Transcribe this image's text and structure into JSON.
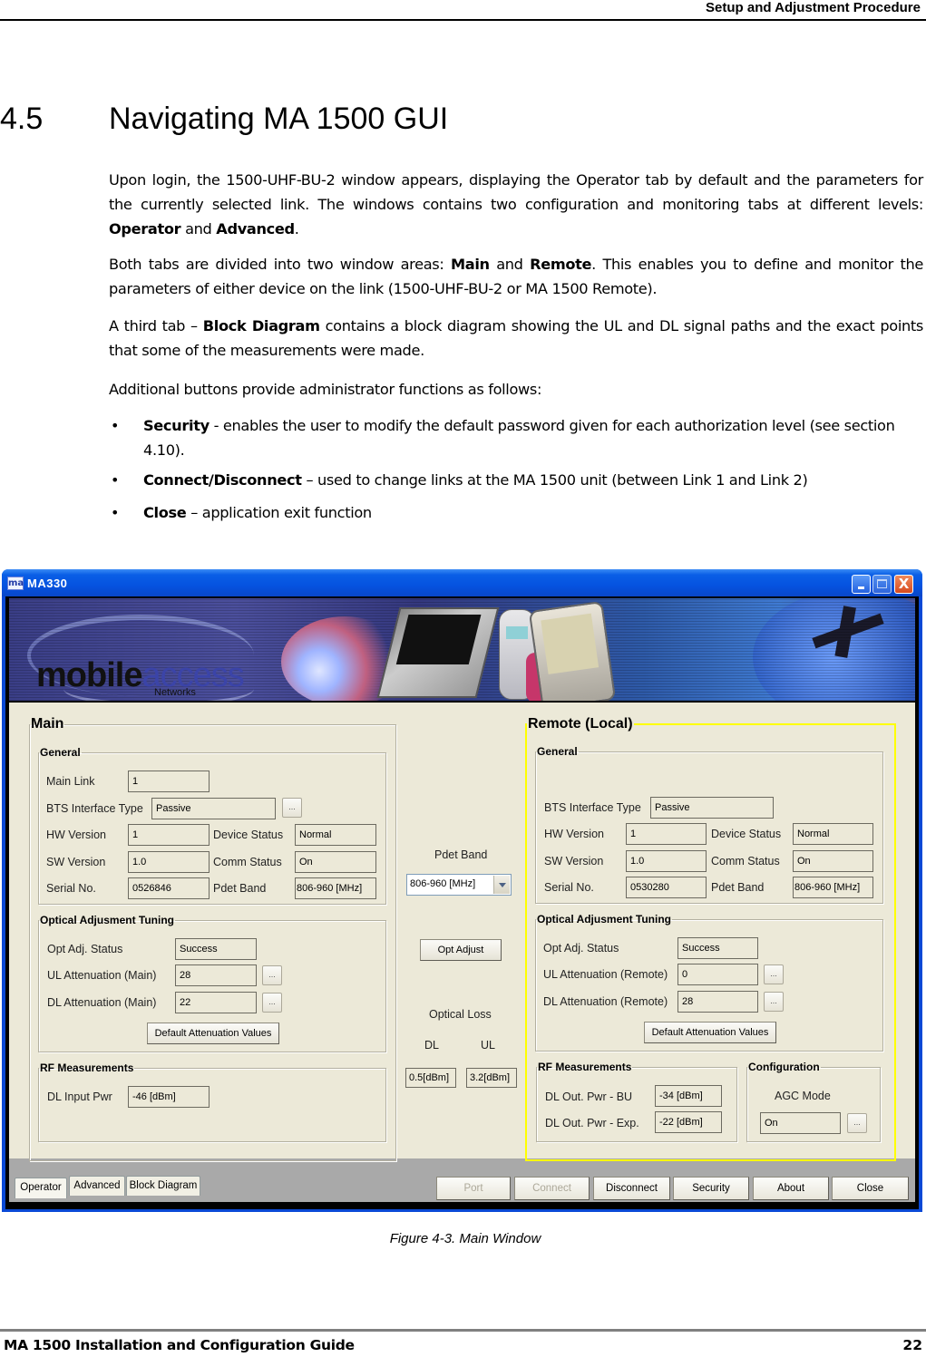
{
  "document": {
    "running_header": "Setup and Adjustment Procedure",
    "section_number": "4.5",
    "section_title": "Navigating MA 1500 GUI",
    "paragraphs": {
      "p1_a": "Upon login, the 1500-UHF-BU-2 window appears, displaying the Operator tab by default and the parameters for the currently selected link.  The windows contains two configuration and monitoring tabs at different levels: ",
      "p1_b1": "Operator",
      "p1_c": " and ",
      "p1_b2": "Advanced",
      "p1_d": ".",
      "p2_a": "Both tabs are divided into two window areas: ",
      "p2_b1": "Main",
      "p2_c": " and ",
      "p2_b2": "Remote",
      "p2_d": ". This enables you to define and monitor the parameters of either device on the link (1500-UHF-BU-2 or MA 1500 Remote).",
      "p3_a": "A third tab – ",
      "p3_b": "Block Diagram",
      "p3_c": " contains a block diagram showing the UL and DL signal paths and the exact points that some of the measurements were made.",
      "p4": "Additional buttons provide administrator functions as follows:"
    },
    "bullets": [
      {
        "term": "Security",
        "text": " - enables the user to modify the default password given for each authorization level (see section 4.10)."
      },
      {
        "term": "Connect/Disconnect",
        "text": " – used to change links at the MA 1500 unit (between Link 1 and Link 2)"
      },
      {
        "term": "Close",
        "text": " – application exit function"
      }
    ],
    "figure_caption": "Figure 4-3. Main Window",
    "footer_title": "MA 1500 Installation and Configuration Guide",
    "page_number": "22"
  },
  "window": {
    "title": "MA330",
    "app_icon_text": "ma",
    "close_glyph": "X",
    "banner": {
      "logo_part1": "mobile",
      "logo_part2": "access",
      "logo_sub": "Networks"
    },
    "main": {
      "legend": "Main",
      "general": {
        "legend": "General",
        "main_link_label": "Main Link",
        "main_link_value": "1",
        "bts_label": "BTS Interface Type",
        "bts_value": "Passive",
        "hw_label": "HW Version",
        "hw_value": "1",
        "sw_label": "SW Version",
        "sw_value": "1.0",
        "serial_label": "Serial No.",
        "serial_value": "0526846",
        "device_status_label": "Device Status",
        "device_status_value": "Normal",
        "comm_status_label": "Comm Status",
        "comm_status_value": "On",
        "pdet_label": "Pdet Band",
        "pdet_value": "806-960 [MHz]"
      },
      "optical": {
        "legend": "Optical Adjusment Tuning",
        "status_label": "Opt Adj. Status",
        "status_value": "Success",
        "ul_label": "UL Attenuation (Main)",
        "ul_value": "28",
        "dl_label": "DL Attenuation (Main)",
        "dl_value": "22",
        "default_button": "Default Attenuation Values"
      },
      "rf": {
        "legend": "RF Measurements",
        "dl_input_label": "DL Input Pwr",
        "dl_input_value": "-46 [dBm]"
      }
    },
    "center": {
      "pdet_band_label": "Pdet Band",
      "pdet_band_selected": "806-960 [MHz]",
      "opt_adjust_button": "Opt Adjust",
      "optical_loss_label": "Optical Loss",
      "dl_label": "DL",
      "ul_label": "UL",
      "dl_value": "0.5[dBm]",
      "ul_value": "3.2[dBm]"
    },
    "remote": {
      "legend": "Remote (Local)",
      "highlight_color": "#ffff00",
      "general": {
        "legend": "General",
        "bts_label": "BTS Interface Type",
        "bts_value": "Passive",
        "hw_label": "HW Version",
        "hw_value": "1",
        "sw_label": "SW Version",
        "sw_value": "1.0",
        "serial_label": "Serial No.",
        "serial_value": "0530280",
        "device_status_label": "Device Status",
        "device_status_value": "Normal",
        "comm_status_label": "Comm Status",
        "comm_status_value": "On",
        "pdet_label": "Pdet Band",
        "pdet_value": "806-960 [MHz]"
      },
      "optical": {
        "legend": "Optical Adjusment Tuning",
        "status_label": "Opt Adj. Status",
        "status_value": "Success",
        "ul_label": "UL Attenuation (Remote)",
        "ul_value": "0",
        "dl_label": "DL Attenuation (Remote)",
        "dl_value": "28",
        "default_button": "Default Attenuation Values"
      },
      "rf": {
        "legend": "RF Measurements",
        "bu_label": "DL Out. Pwr - BU",
        "bu_value": "-34 [dBm]",
        "exp_label": "DL Out. Pwr - Exp.",
        "exp_value": "-22 [dBm]"
      },
      "config": {
        "legend": "Configuration",
        "agc_label": "AGC Mode",
        "agc_value": "On"
      }
    },
    "dots_label": "...",
    "tabs": [
      {
        "label": "Operator",
        "active": true
      },
      {
        "label": "Advanced",
        "active": false
      },
      {
        "label": "Block Diagram",
        "active": false
      }
    ],
    "buttons": {
      "port": "Port",
      "connect": "Connect",
      "disconnect": "Disconnect",
      "security": "Security",
      "about": "About",
      "close": "Close"
    }
  }
}
